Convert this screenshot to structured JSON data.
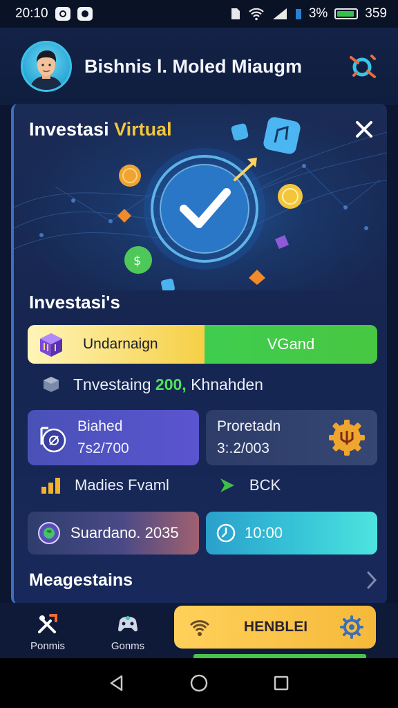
{
  "status_bar": {
    "time": "20:10",
    "battery_percent": "3%",
    "right_value": "359"
  },
  "header": {
    "title": "Bishnis l. Moled Miaugm",
    "avatar_icon": "avatar-person-icon",
    "action_icon": "orbit-search-icon"
  },
  "card": {
    "title_part1": "Investasi",
    "title_part2": "Virtual",
    "close_icon": "close-icon",
    "section_heading": "Investasi's",
    "toggle": {
      "left_label": "Undarnaign",
      "right_label": "VGand"
    },
    "info_row": {
      "prefix": "Tnvestaing",
      "highlight": "200,",
      "suffix": "Khnahden"
    },
    "stats": [
      {
        "label": "Biahed",
        "value": "7s2/700",
        "icon": "fitness-badge-icon"
      },
      {
        "label": "Proretadn",
        "value": "3:.2/003",
        "icon": "gear-badge-icon"
      }
    ],
    "mini_row": [
      {
        "label": "Madies Fvaml",
        "icon": "bar-chart-icon"
      },
      {
        "label": "BCK",
        "icon": "play-arrow-icon"
      }
    ],
    "pills": [
      {
        "label": "Suardano. 2035",
        "icon": "globe-badge-icon"
      },
      {
        "label": "10:00",
        "icon": "clock-icon"
      }
    ],
    "more_label": "Meagestains"
  },
  "bottom_nav": {
    "items": [
      {
        "label": "Ponmis",
        "icon": "tools-icon"
      },
      {
        "label": "Gonms",
        "icon": "gamepad-icon"
      }
    ],
    "cta_label": "HENBLEI"
  },
  "colors": {
    "background": "#0c1630",
    "accent_yellow": "#f2c53c",
    "accent_green": "#48c742",
    "accent_purple": "#5b55d0",
    "accent_cyan": "#39c9d8"
  }
}
